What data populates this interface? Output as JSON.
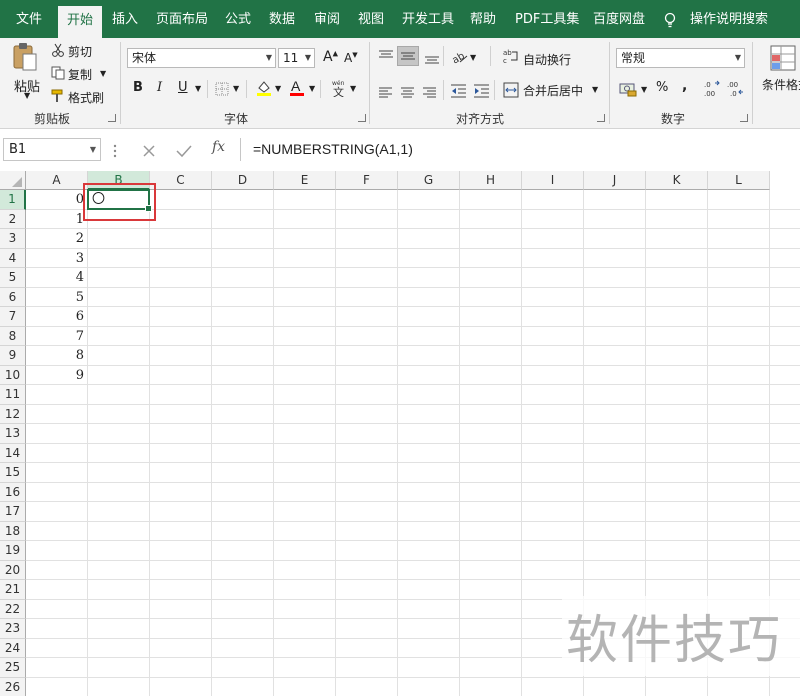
{
  "menu": {
    "tabs": [
      {
        "label": "文件"
      },
      {
        "label": "开始"
      },
      {
        "label": "插入"
      },
      {
        "label": "页面布局"
      },
      {
        "label": "公式"
      },
      {
        "label": "数据"
      },
      {
        "label": "审阅"
      },
      {
        "label": "视图"
      },
      {
        "label": "开发工具"
      },
      {
        "label": "帮助"
      },
      {
        "label": "PDF工具集"
      },
      {
        "label": "百度网盘"
      }
    ],
    "search_label": "操作说明搜索"
  },
  "ribbon": {
    "clipboard": {
      "paste": "粘贴",
      "cut": "剪切",
      "copy": "复制",
      "format_painter": "格式刷",
      "label": "剪贴板"
    },
    "font": {
      "name": "宋体",
      "size": "11",
      "bold": "B",
      "italic": "I",
      "underline": "U",
      "grow": "A",
      "shrink": "A",
      "label": "字体"
    },
    "alignment": {
      "wrap_text": "自动换行",
      "merge_center": "合并后居中",
      "label": "对齐方式"
    },
    "number": {
      "format": "常规",
      "percent": "%",
      "comma": ",",
      "label": "数字"
    },
    "styles": {
      "cond_format": "条件格式"
    }
  },
  "formula_bar": {
    "name_box": "B1",
    "fx": "fx",
    "formula": "=NUMBERSTRING(A1,1)"
  },
  "sheet": {
    "columns": [
      "A",
      "B",
      "C",
      "D",
      "E",
      "F",
      "G",
      "H",
      "I",
      "J",
      "K",
      "L"
    ],
    "selected_column": "B",
    "rows": [
      "1",
      "2",
      "3",
      "4",
      "5",
      "6",
      "7",
      "8",
      "9",
      "10",
      "11",
      "12",
      "13",
      "14",
      "15",
      "16",
      "17",
      "18",
      "19",
      "20",
      "21",
      "22",
      "23",
      "24",
      "25",
      "26"
    ],
    "col_a_values": [
      "0",
      "1",
      "2",
      "3",
      "4",
      "5",
      "6",
      "7",
      "8",
      "9"
    ],
    "b1_value": "〇"
  },
  "watermark": "软件技巧",
  "colors": {
    "excel_green": "#217346",
    "highlight_red": "#d9383a",
    "fill_yellow": "#ffff00",
    "font_red": "#ff0000"
  }
}
